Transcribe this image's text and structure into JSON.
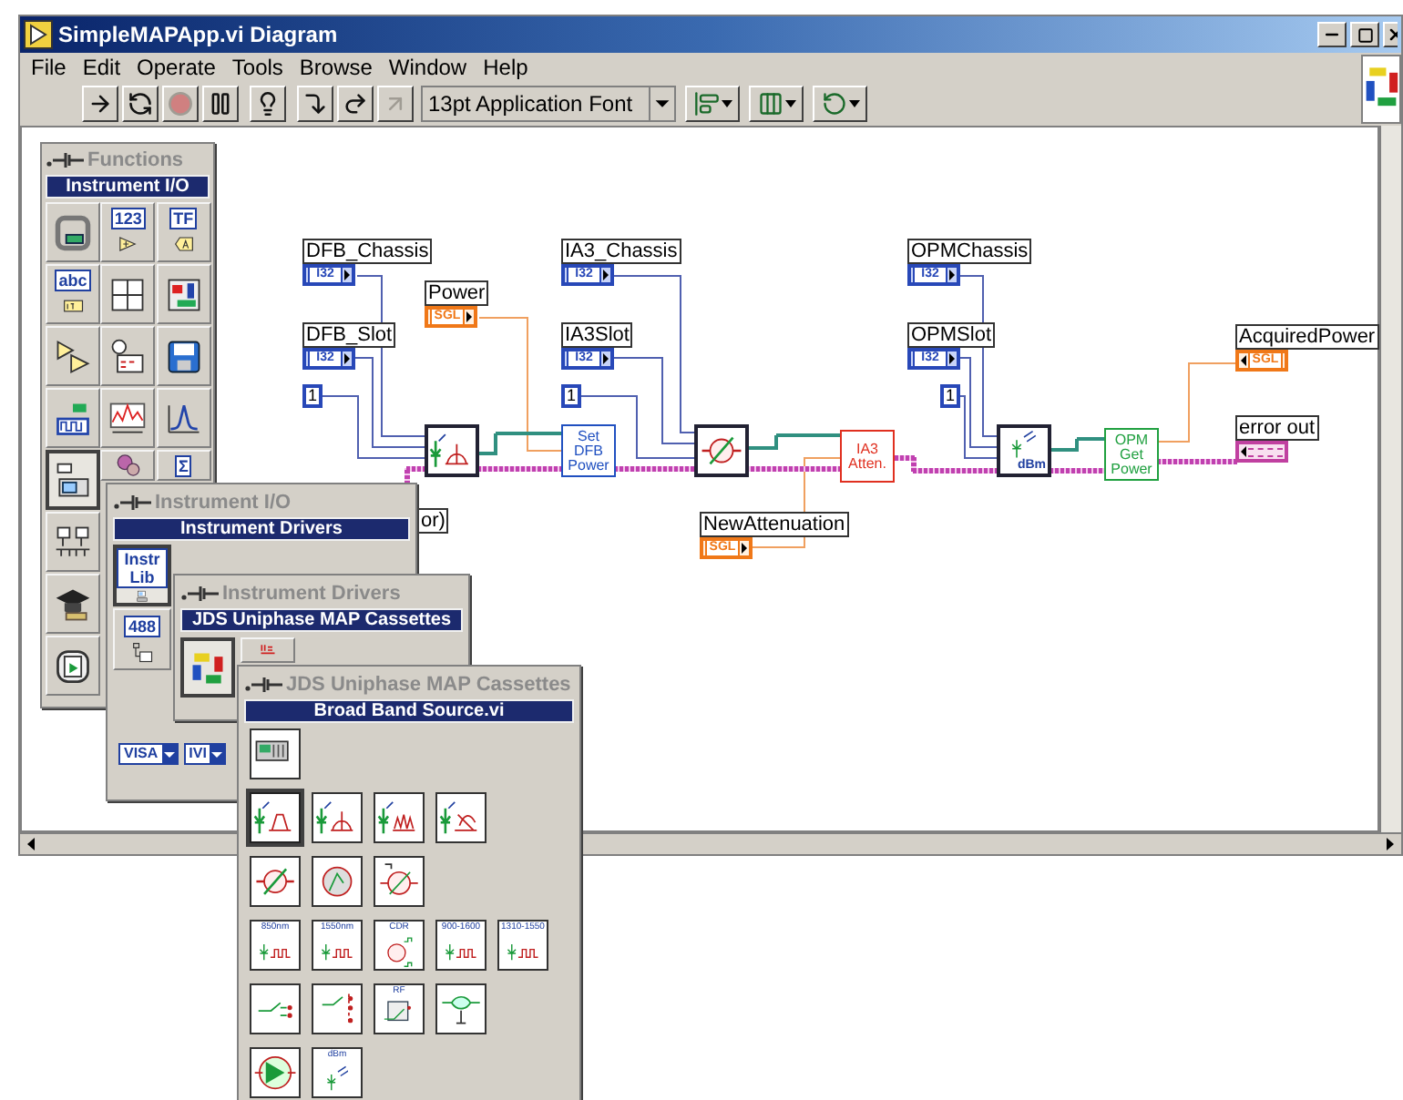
{
  "window": {
    "title": "SimpleMAPApp.vi Diagram"
  },
  "menu": [
    "File",
    "Edit",
    "Operate",
    "Tools",
    "Browse",
    "Window",
    "Help"
  ],
  "toolbar": {
    "buttons": [
      {
        "kind": "run",
        "disabled": false
      },
      {
        "kind": "run-continuously",
        "disabled": false
      },
      {
        "kind": "abort",
        "disabled": true
      },
      {
        "kind": "pause",
        "disabled": false
      },
      {
        "kind": "highlight",
        "disabled": false
      },
      {
        "kind": "step-into",
        "disabled": false
      },
      {
        "kind": "step-over",
        "disabled": false
      },
      {
        "kind": "step-out",
        "disabled": true
      }
    ],
    "font": "13pt Application Font",
    "menus": [
      {
        "kind": "align"
      },
      {
        "kind": "distribute"
      },
      {
        "kind": "reorder"
      }
    ]
  },
  "diagram": {
    "terminals": [
      {
        "label": "DFB_Chassis",
        "type": "I32",
        "kind": "control"
      },
      {
        "label": "IA3_Chassis",
        "type": "I32",
        "kind": "control"
      },
      {
        "label": "OPMChassis",
        "type": "I32",
        "kind": "control"
      },
      {
        "label": "Power",
        "type": "SGL",
        "kind": "control"
      },
      {
        "label": "DFB_Slot",
        "type": "I32",
        "kind": "control"
      },
      {
        "label": "IA3Slot",
        "type": "I32",
        "kind": "control"
      },
      {
        "label": "OPMSlot",
        "type": "I32",
        "kind": "control"
      },
      {
        "label": "AcquiredPower",
        "type": "SGL",
        "kind": "indicator"
      },
      {
        "label": "error out",
        "kind": "error-indicator"
      },
      {
        "label": "NewAttenuation",
        "type": "SGL",
        "kind": "control"
      }
    ],
    "constants": [
      "1",
      "1",
      "1"
    ],
    "partial_label": "or)",
    "nodes": [
      {
        "kind": "dfb-source"
      },
      {
        "kind": "subvi",
        "text": "Set DFB Power",
        "color": "#2050c0"
      },
      {
        "kind": "attenuator"
      },
      {
        "kind": "subvi",
        "text": "IA3 Atten.",
        "color": "#e03020"
      },
      {
        "kind": "power-meter",
        "caption": "dBm"
      },
      {
        "kind": "subvi",
        "text": "OPM Get Power",
        "color": "#20a040"
      }
    ]
  },
  "functions_palette": {
    "title": "Functions",
    "header": "Instrument I/O",
    "items": [
      {
        "kind": "panel",
        "selected": false
      },
      {
        "kind": "numeric",
        "caption": "123",
        "selected": false
      },
      {
        "kind": "boolean",
        "caption": "TF",
        "selected": false
      },
      {
        "kind": "string",
        "caption": "abc",
        "selected": false
      },
      {
        "kind": "array",
        "selected": false
      },
      {
        "kind": "cluster",
        "selected": false
      },
      {
        "kind": "comparison",
        "selected": false
      },
      {
        "kind": "timing",
        "selected": false
      },
      {
        "kind": "file",
        "selected": false
      },
      {
        "kind": "daq",
        "selected": false
      },
      {
        "kind": "waveform",
        "selected": false
      },
      {
        "kind": "analysis",
        "selected": false
      },
      {
        "kind": "instrument",
        "selected": true
      },
      {
        "kind": "control",
        "selected": false
      },
      {
        "kind": "math",
        "caption": "Σ",
        "selected": false
      },
      {
        "kind": "comm",
        "selected": false
      },
      {
        "kind": "tutorial",
        "selected": false
      },
      {
        "kind": "express",
        "selected": false
      }
    ]
  },
  "instrument_io_palette": {
    "title": "Instrument I/O",
    "header": "Instrument Drivers",
    "items": [
      {
        "kind": "instr-lib",
        "caption": "Instr Lib",
        "selected": true
      },
      {
        "kind": "gpib",
        "caption": "488",
        "selected": false
      }
    ],
    "menus": [
      "VISA",
      "IVI"
    ]
  },
  "drivers_palette": {
    "title": "Instrument Drivers",
    "header": "JDS Uniphase MAP Cassettes",
    "items": [
      {
        "kind": "logo",
        "selected": true
      },
      {
        "kind": "hp",
        "selected": false
      }
    ]
  },
  "cassettes_palette": {
    "title": "JDS Uniphase MAP Cassettes",
    "header": "Broad Band Source.vi",
    "rows": [
      [
        {
          "kind": "instrument-front",
          "selected": false
        }
      ],
      [
        {
          "kind": "source-filter",
          "selected": true
        },
        {
          "kind": "source",
          "selected": false
        },
        {
          "kind": "source-noise",
          "selected": false
        },
        {
          "kind": "source-tune",
          "selected": false
        }
      ],
      [
        {
          "kind": "attenuator",
          "selected": false
        },
        {
          "kind": "attenuator-meter",
          "selected": false
        },
        {
          "kind": "attenuator-reset",
          "selected": false
        }
      ],
      [
        {
          "kind": "source-pulse",
          "caption": "850nm",
          "selected": false
        },
        {
          "kind": "source-pulse",
          "caption": "1550nm",
          "selected": false
        },
        {
          "kind": "cdr",
          "caption": "CDR",
          "selected": false
        },
        {
          "kind": "source-pulse",
          "caption": "900-1600",
          "selected": false
        },
        {
          "kind": "source-pulse",
          "caption": "1310-1550",
          "selected": false
        }
      ],
      [
        {
          "kind": "switch",
          "selected": false
        },
        {
          "kind": "switch-multi",
          "selected": false
        },
        {
          "kind": "rf",
          "caption": "RF",
          "selected": false
        },
        {
          "kind": "coupler",
          "selected": false
        }
      ],
      [
        {
          "kind": "amplifier",
          "selected": false
        },
        {
          "kind": "power-meter",
          "caption": "dBm",
          "selected": false
        }
      ]
    ]
  }
}
